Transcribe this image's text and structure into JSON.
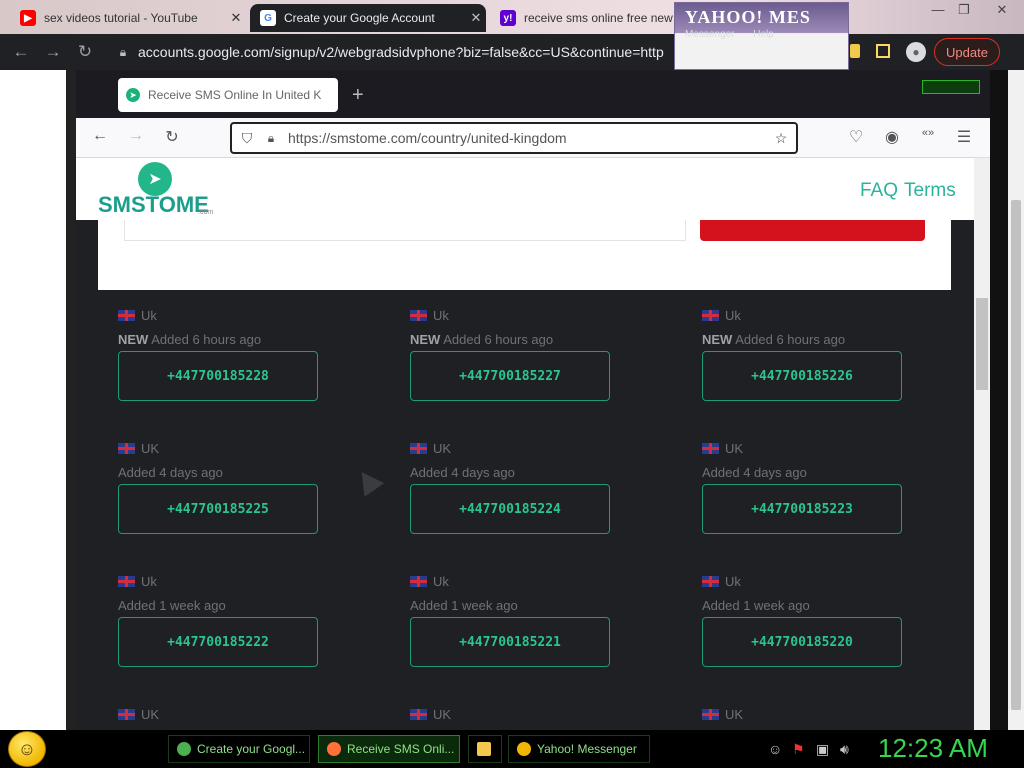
{
  "chrome": {
    "tabs": [
      {
        "title": "sex videos tutorial - YouTube",
        "favicon": "youtube-icon",
        "color": "#ff0000"
      },
      {
        "title": "Create your Google Account",
        "favicon": "google-icon",
        "color": "#4285f4"
      },
      {
        "title": "receive sms online free new",
        "favicon": "yahoo-icon",
        "color": "#6001d2"
      }
    ],
    "url": "accounts.google.com/signup/v2/webgradsidvphone?biz=false&cc=US&continue=http",
    "update_label": "Update"
  },
  "yahoo_popup": {
    "logo": "YAHOO! MES",
    "menu": "Messenger Help"
  },
  "firefox": {
    "tab_title": "Receive SMS Online In United K",
    "url": "https://smstome.com/country/united-kingdom"
  },
  "site": {
    "logo_text": "SMSTOME",
    "logo_sub": ".com",
    "nav": [
      "FAQ",
      "Terms"
    ],
    "accent": "#2bb39b",
    "numbers": [
      {
        "country": "Uk",
        "badge": "NEW",
        "added": "Added 6 hours ago",
        "number": "+447700185228"
      },
      {
        "country": "Uk",
        "badge": "NEW",
        "added": "Added 6 hours ago",
        "number": "+447700185227"
      },
      {
        "country": "Uk",
        "badge": "NEW",
        "added": "Added 6 hours ago",
        "number": "+447700185226"
      },
      {
        "country": "UK",
        "badge": "",
        "added": "Added 4 days ago",
        "number": "+447700185225"
      },
      {
        "country": "UK",
        "badge": "",
        "added": "Added 4 days ago",
        "number": "+447700185224"
      },
      {
        "country": "UK",
        "badge": "",
        "added": "Added 4 days ago",
        "number": "+447700185223"
      },
      {
        "country": "Uk",
        "badge": "",
        "added": "Added 1 week ago",
        "number": "+447700185222"
      },
      {
        "country": "Uk",
        "badge": "",
        "added": "Added 1 week ago",
        "number": "+447700185221"
      },
      {
        "country": "Uk",
        "badge": "",
        "added": "Added 1 week ago",
        "number": "+447700185220"
      },
      {
        "country": "UK",
        "badge": "",
        "added": "",
        "number": ""
      },
      {
        "country": "UK",
        "badge": "",
        "added": "",
        "number": ""
      },
      {
        "country": "UK",
        "badge": "",
        "added": "",
        "number": ""
      }
    ]
  },
  "taskbar": {
    "tasks": [
      {
        "label": "Create your Googl...",
        "icon": "chrome-icon",
        "color": "#4caf50"
      },
      {
        "label": "Receive SMS Onli...",
        "icon": "firefox-icon",
        "color": "#ff7139"
      },
      {
        "label": "",
        "icon": "folder-icon",
        "color": "#f2c94c"
      },
      {
        "label": "Yahoo! Messenger",
        "icon": "yahoo-smiley-icon",
        "color": "#f1b600"
      }
    ],
    "clock": "12:23 AM"
  }
}
